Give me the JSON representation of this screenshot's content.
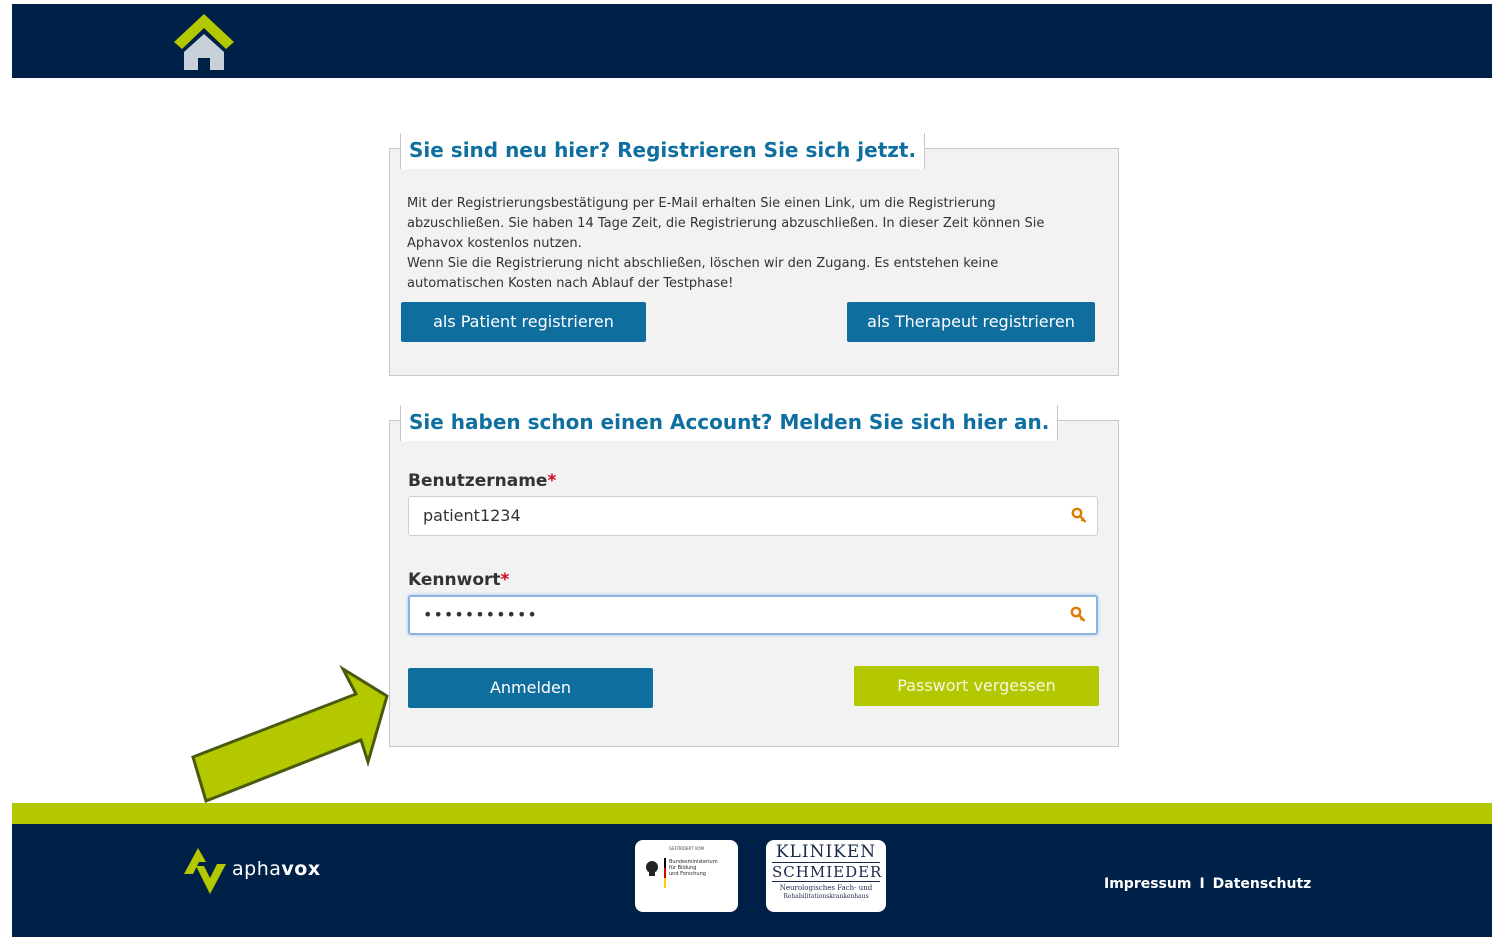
{
  "register": {
    "title": "Sie sind neu hier? Registrieren Sie sich jetzt.",
    "description_lines": [
      "Mit der Registrierungsbestätigung per E-Mail erhalten Sie einen Link, um die Registrierung",
      "abzuschließen. Sie haben 14 Tage Zeit, die Registrierung abzuschließen. In dieser Zeit können Sie",
      "Aphavox kostenlos nutzen.",
      "Wenn Sie die Registrierung nicht abschließen, löschen wir den Zugang. Es entstehen keine",
      "automatischen Kosten nach Ablauf der Testphase!"
    ],
    "patient_button": "als Patient registrieren",
    "therapist_button": "als Therapeut registrieren"
  },
  "login": {
    "title": "Sie haben schon einen Account? Melden Sie sich hier an.",
    "username_label": "Benutzername",
    "username_value": "patient1234",
    "password_label": "Kennwort",
    "password_value": "•••••••••••",
    "required_mark": "*",
    "login_button": "Anmelden",
    "forgot_button": "Passwort vergessen"
  },
  "footer": {
    "brand_light": "apha",
    "brand_bold": "vox",
    "bmbf_top": "GEFÖRDERT VOM",
    "bmbf_lines": [
      "Bundesministerium",
      "für Bildung",
      "und Forschung"
    ],
    "kliniken_line1": "KLINIKEN",
    "kliniken_line2": "SCHMIEDER",
    "kliniken_line3": "Neurologisches Fach- und",
    "kliniken_line4": "Rehabilitationskrankenhaus",
    "impressum": "Impressum",
    "separator": "I",
    "datenschutz": "Datenschutz"
  },
  "icons": {
    "home": "home-icon",
    "key": "key-icon",
    "arrow": "arrow-icon",
    "logo": "aphavox-logo-icon"
  },
  "colors": {
    "navy": "#002147",
    "blue": "#0f6e9e",
    "lime": "#b4c800",
    "required": "#d0021b"
  }
}
